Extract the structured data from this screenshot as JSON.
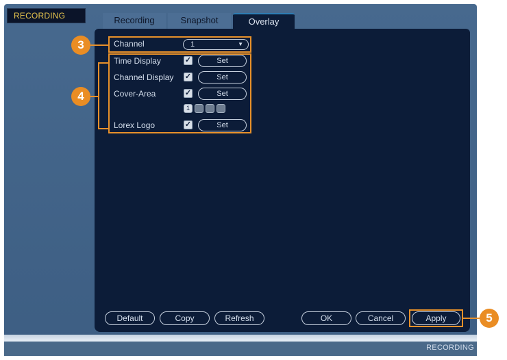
{
  "window": {
    "title": "RECORDING"
  },
  "tabs": [
    {
      "label": "Recording",
      "active": false
    },
    {
      "label": "Snapshot",
      "active": false
    },
    {
      "label": "Overlay",
      "active": true
    }
  ],
  "channel": {
    "label": "Channel",
    "value": "1"
  },
  "overlay_rows": [
    {
      "label": "Time Display",
      "checked": true,
      "button": "Set"
    },
    {
      "label": "Channel Display",
      "checked": true,
      "button": "Set"
    },
    {
      "label": "Cover-Area",
      "checked": true,
      "button": "Set"
    },
    {
      "label": "Lorex Logo",
      "checked": true,
      "button": "Set"
    }
  ],
  "cover_area_slots": [
    {
      "label": "1",
      "selected": true
    },
    {
      "label": "",
      "selected": false
    },
    {
      "label": "",
      "selected": false
    },
    {
      "label": "",
      "selected": false
    }
  ],
  "footer_buttons": {
    "default": "Default",
    "copy": "Copy",
    "refresh": "Refresh",
    "ok": "OK",
    "cancel": "Cancel",
    "apply": "Apply"
  },
  "callouts": [
    "3",
    "4",
    "5"
  ],
  "status_bar": {
    "label": "RECORDING"
  },
  "colors": {
    "panel": "#0c1c38",
    "title_text": "#e8c64e",
    "callout": "#ea8d24",
    "frame": "#47698e"
  }
}
